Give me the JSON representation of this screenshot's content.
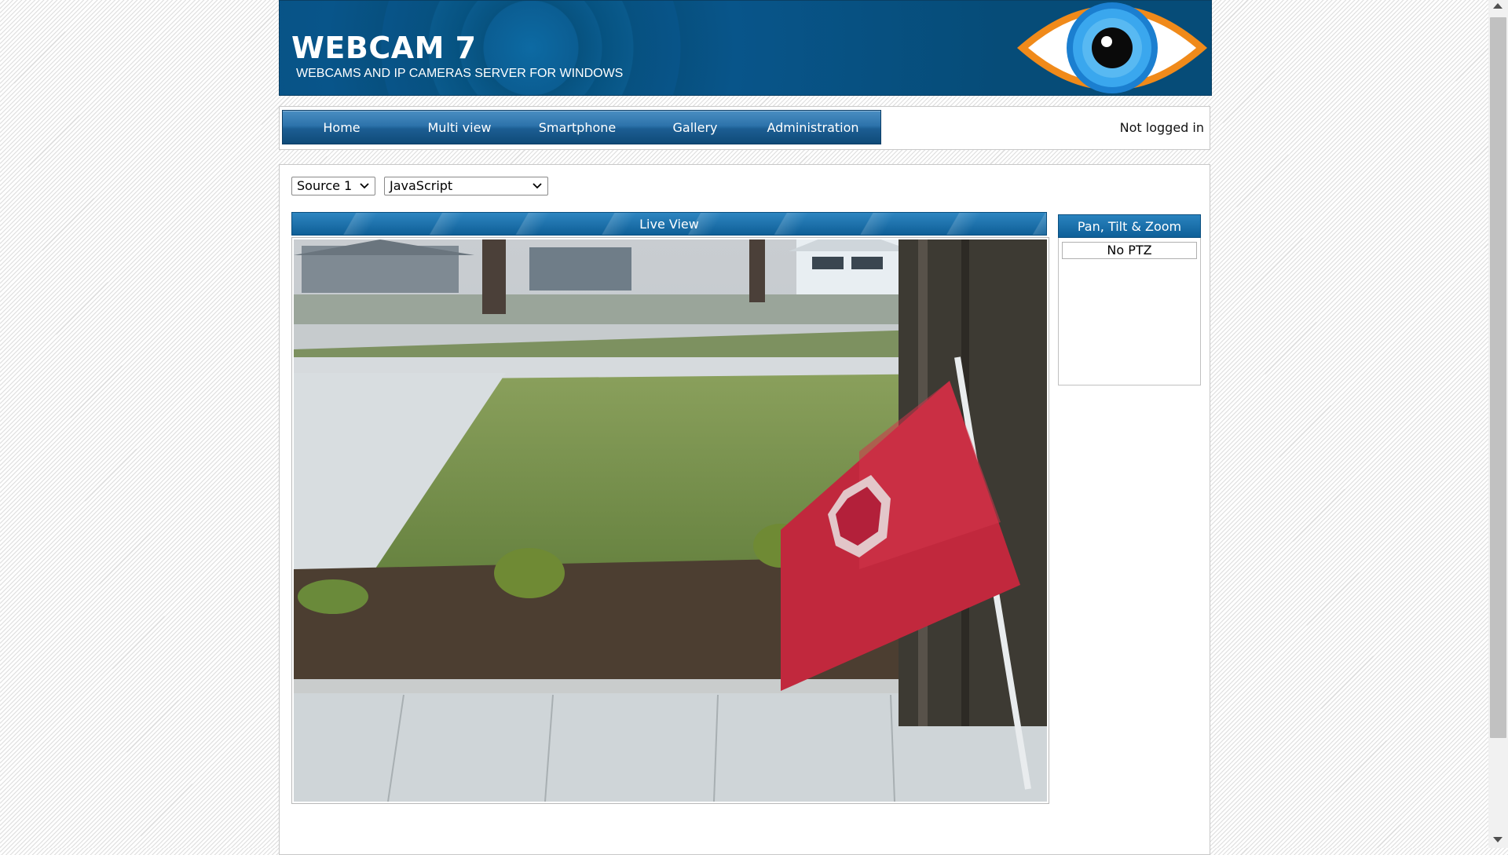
{
  "header": {
    "title": "WEBCAM 7",
    "subtitle": "WEBCAMS AND IP CAMERAS SERVER FOR WINDOWS",
    "logo_icon": "eye-icon"
  },
  "nav": {
    "items": [
      {
        "label": "Home"
      },
      {
        "label": "Multi view"
      },
      {
        "label": "Smartphone"
      },
      {
        "label": "Gallery"
      },
      {
        "label": "Administration"
      }
    ],
    "login_status": "Not logged in"
  },
  "controls": {
    "source_select": {
      "value": "Source 1"
    },
    "viewer_select": {
      "value": "JavaScript"
    }
  },
  "live_view": {
    "title": "Live View",
    "image_alt": "camera-feed"
  },
  "ptz": {
    "title": "Pan, Tilt & Zoom",
    "status": "No PTZ"
  },
  "colors": {
    "header_blue": "#0a5a8c",
    "nav_blue": "#1c5e93",
    "panel_head_blue": "#1a6fa8",
    "eye_iris": "#29a3e8",
    "eye_ring": "#f08a1a"
  }
}
